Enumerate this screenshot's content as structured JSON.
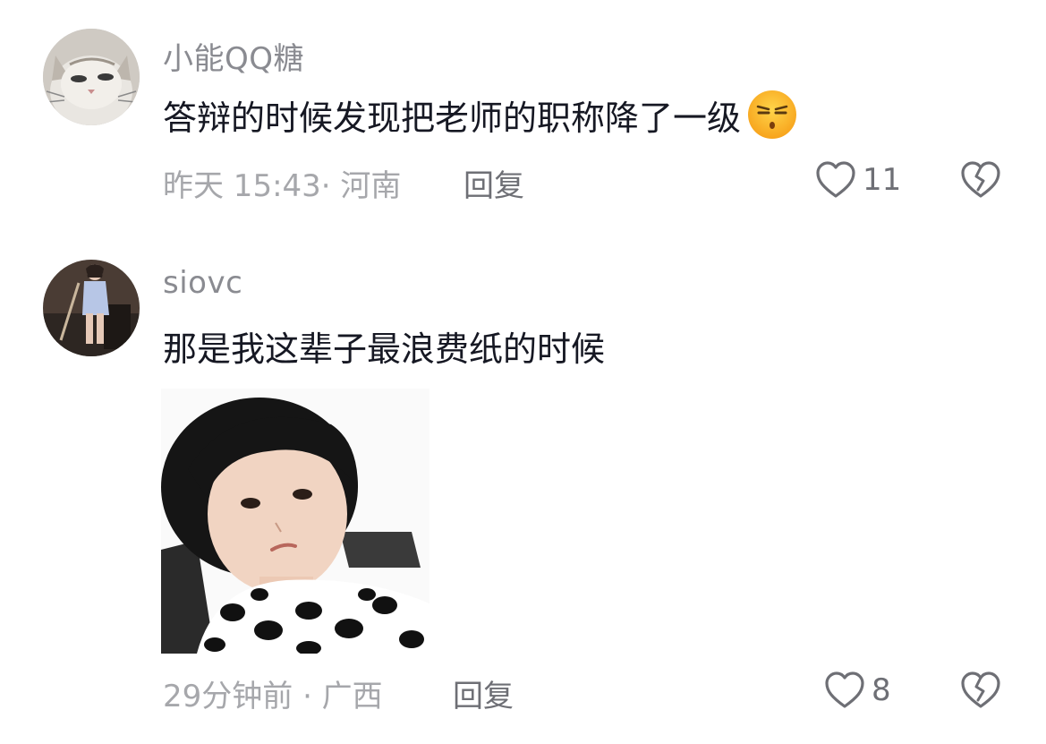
{
  "comments": [
    {
      "username": "小能QQ糖",
      "text": "答辩的时候发现把老师的职称降了一级",
      "emoji": "smirking-face-emoji",
      "meta": "昨天 15:43· 河南",
      "reply_label": "回复",
      "like_count": "11",
      "avatar": "cat-avatar"
    },
    {
      "username": "siovc",
      "text": "那是我这辈子最浪费纸的时候",
      "sticker": "child-meme-sticker",
      "meta": "29分钟前 · 广西",
      "reply_label": "回复",
      "like_count": "8",
      "avatar": "person-avatar"
    }
  ],
  "icons": {
    "like": "heart-outline-icon",
    "dislike": "broken-heart-icon"
  },
  "colors": {
    "username": "#8a8b91",
    "text": "#161823",
    "meta": "#a6a7ab",
    "action": "#6e6f75"
  }
}
